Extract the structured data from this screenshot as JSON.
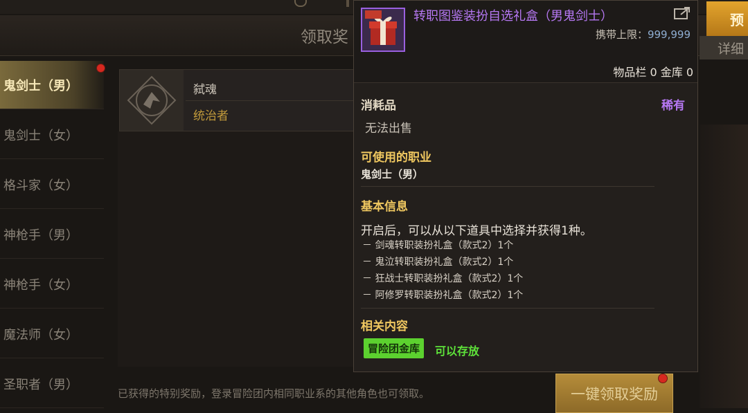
{
  "header": {
    "title": "领取奖"
  },
  "sidebar": {
    "items": [
      {
        "label": "鬼剑士（男）",
        "active": true
      },
      {
        "label": "鬼剑士（女）"
      },
      {
        "label": "格斗家（女）"
      },
      {
        "label": "神枪手（男）"
      },
      {
        "label": "神枪手（女）"
      },
      {
        "label": "魔法师（女）"
      },
      {
        "label": "圣职者（男）"
      }
    ]
  },
  "reward": {
    "name": "弑魂",
    "title": "统治者"
  },
  "bottom_note": "已获得的特别奖励，登录冒险团内相同职业系的其他角色也可领取。",
  "claim_button": "一键领取奖励",
  "right": {
    "button": "预",
    "tab": "详细"
  },
  "tooltip": {
    "item_name": "转职图鉴装扮自选礼盒（男鬼剑士）",
    "carry_limit_label": "携带上限：",
    "carry_limit_value": "999,999",
    "storage": "物品栏 0 金库 0",
    "type": "消耗品",
    "rarity": "稀有",
    "no_sell": "无法出售",
    "usable_class_title": "可使用的职业",
    "usable_class": "鬼剑士（男）",
    "basic_info_title": "基本信息",
    "description": "开启后，可以从以下道具中选择并获得1种。",
    "options": [
      "－ 剑魂转职装扮礼盒（款式2）1个",
      "－ 鬼泣转职装扮礼盒（款式2）1个",
      "－ 狂战士转职装扮礼盒（款式2）1个",
      "－ 阿修罗转职装扮礼盒（款式2）1个"
    ],
    "related_title": "相关内容",
    "related_tag": "冒险团金库",
    "related_status": "可以存放"
  },
  "colors": {
    "rarity_purple": "#b678f3",
    "section_gold": "#f0c860",
    "store_green": "#5ee33a"
  }
}
